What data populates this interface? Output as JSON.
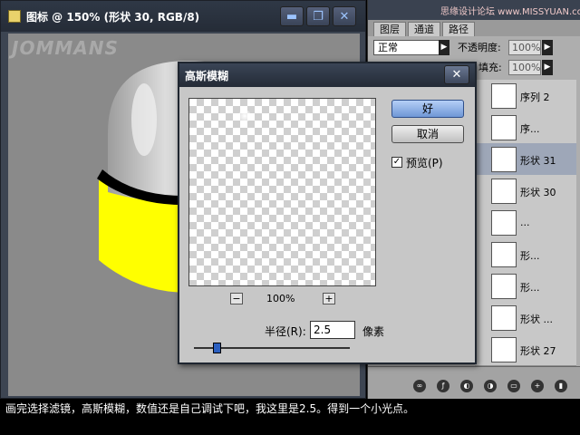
{
  "document": {
    "title": "图标 @ 150% (形状 30, RGB/8)",
    "watermark": "JOMMANS",
    "min_glyph": "▬",
    "max_glyph": "❐",
    "close_glyph": "✕"
  },
  "panel": {
    "site": "思缘设计论坛 www.MISSYUAN.com",
    "tabs": [
      "图层",
      "通道",
      "路径"
    ],
    "blend_mode": "正常",
    "opacity_label": "不透明度:",
    "opacity_value": "100%",
    "fill_label": "填充:",
    "fill_value": "100%",
    "arrow_glyph": "▶",
    "layers": [
      {
        "name": "序列 2",
        "selected": false
      },
      {
        "name": "序...",
        "selected": false
      },
      {
        "name": "形状 31",
        "selected": true
      },
      {
        "name": "形状 30",
        "selected": false
      },
      {
        "name": "...",
        "selected": false
      },
      {
        "name": "形...",
        "selected": false
      },
      {
        "name": "形...",
        "selected": false
      },
      {
        "name": "形状 ...",
        "selected": false
      },
      {
        "name": "形状 27",
        "selected": false
      }
    ],
    "bottom_icons": [
      "link-icon",
      "fx-icon",
      "mask-icon",
      "adjustment-icon",
      "folder-icon",
      "new-layer-icon",
      "trash-icon"
    ]
  },
  "dialog": {
    "title": "高斯模糊",
    "close_glyph": "✕",
    "ok_label": "好",
    "cancel_label": "取消",
    "preview_checked": true,
    "check_glyph": "✓",
    "preview_label": "预览(P)",
    "zoom_minus": "−",
    "zoom_plus": "+",
    "zoom_value": "100%",
    "radius_label": "半径(R):",
    "radius_value": "2.5",
    "radius_unit": "像素",
    "radius_slider_fraction": 0.015
  },
  "caption": "画完选择滤镜，高斯模糊，数值还是自己调试下吧，我这里是2.5。得到一个小光点。",
  "colors": {
    "yellow": "#ffff00",
    "selected_layer": "#9ea7b8",
    "ok_button": "#6f97d6"
  }
}
